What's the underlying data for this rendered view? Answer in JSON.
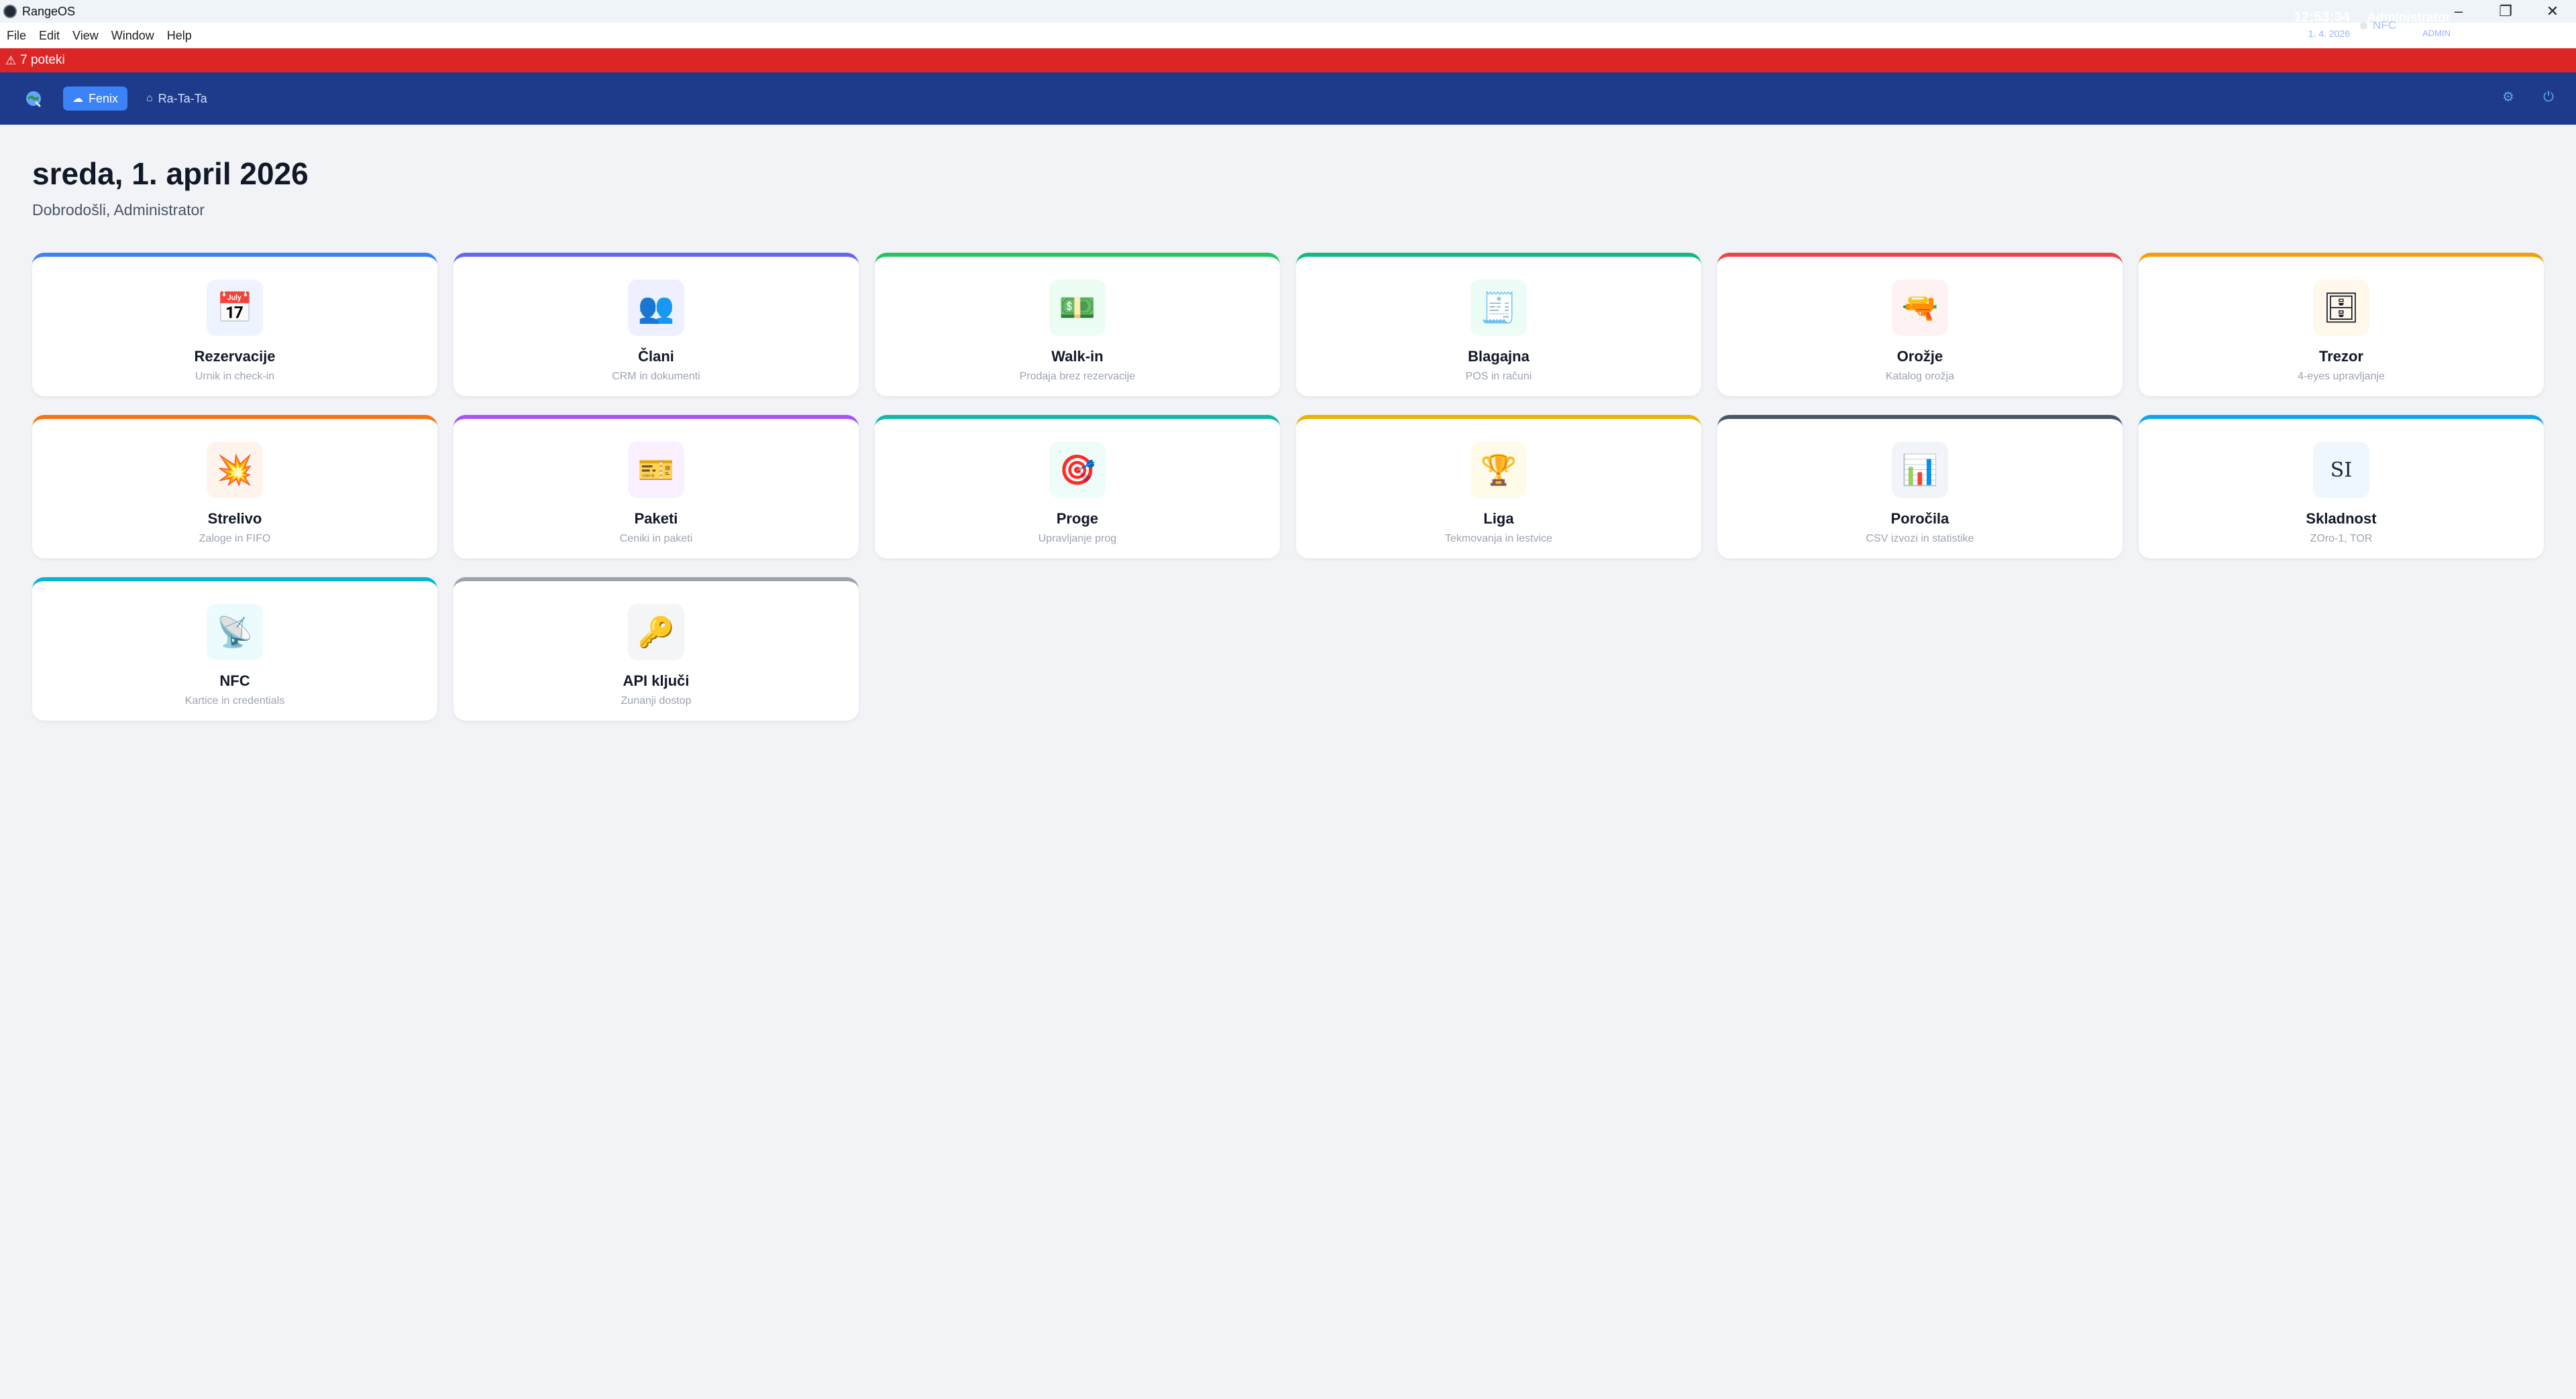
{
  "window": {
    "title": "RangeOS",
    "controls": {
      "minimize": "–",
      "restore": "❐",
      "close": "✕"
    }
  },
  "menu": [
    "File",
    "Edit",
    "View",
    "Window",
    "Help"
  ],
  "alert": {
    "icon": "warning-icon",
    "text": "7 poteki",
    "color": "#dc2626"
  },
  "header": {
    "bg": "#1e3a8a",
    "accent": "#3b82f6",
    "locations": [
      {
        "label": "Fenix",
        "icon": "cloud-icon",
        "active": true
      },
      {
        "label": "Ra-Ta-Ta",
        "icon": "building-icon",
        "active": false
      }
    ],
    "time": "12:53:34",
    "date": "1. 4. 2026",
    "nfc_label": "NFC",
    "user_name": "Administrator",
    "user_role": "ADMIN",
    "icons": [
      "settings-icon",
      "power-icon"
    ]
  },
  "main": {
    "title": "sreda, 1. april 2026",
    "subtitle": "Dobrodošli, Administrator"
  },
  "tiles": [
    {
      "title": "Rezervacije",
      "subtitle": "Urnik in check-in",
      "icon": "calendar-icon",
      "glyph": "📅",
      "accent": "#3b82f6",
      "bg": "#eef4ff"
    },
    {
      "title": "Člani",
      "subtitle": "CRM in dokumenti",
      "icon": "members-icon",
      "glyph": "👥",
      "accent": "#6366f1",
      "bg": "#eef0ff"
    },
    {
      "title": "Walk-in",
      "subtitle": "Prodaja brez rezervacije",
      "icon": "cash-icon",
      "glyph": "💵",
      "accent": "#22c55e",
      "bg": "#ecfdf3"
    },
    {
      "title": "Blagajna",
      "subtitle": "POS in računi",
      "icon": "receipt-icon",
      "glyph": "🧾",
      "accent": "#10b981",
      "bg": "#ecfdf5"
    },
    {
      "title": "Orožje",
      "subtitle": "Katalog orožja",
      "icon": "gun-icon",
      "glyph": "🔫",
      "accent": "#ef4444",
      "bg": "#fef2f2"
    },
    {
      "title": "Trezor",
      "subtitle": "4-eyes upravljanje",
      "icon": "safe-icon",
      "glyph": "🗄",
      "accent": "#f59e0b",
      "bg": "#fff8eb"
    },
    {
      "title": "Strelivo",
      "subtitle": "Zaloge in FIFO",
      "icon": "explosion-icon",
      "glyph": "💥",
      "accent": "#f97316",
      "bg": "#fff4ec"
    },
    {
      "title": "Paketi",
      "subtitle": "Ceniki in paketi",
      "icon": "ticket-icon",
      "glyph": "🎫",
      "accent": "#a855f7",
      "bg": "#faf0ff"
    },
    {
      "title": "Proge",
      "subtitle": "Upravljanje prog",
      "icon": "target-icon",
      "glyph": "🎯",
      "accent": "#14b8a6",
      "bg": "#eefcfa"
    },
    {
      "title": "Liga",
      "subtitle": "Tekmovanja in lestvice",
      "icon": "trophy-icon",
      "glyph": "🏆",
      "accent": "#eab308",
      "bg": "#fffbea"
    },
    {
      "title": "Poročila",
      "subtitle": "CSV izvozi in statistike",
      "icon": "chart-icon",
      "glyph": "📊",
      "accent": "#475569",
      "bg": "#f1f4f8"
    },
    {
      "title": "Skladnost",
      "subtitle": "ZOro-1, TOR",
      "icon": "compliance-icon",
      "glyph": "SI",
      "accent": "#0ea5e9",
      "bg": "#eef7fd"
    },
    {
      "title": "NFC",
      "subtitle": "Kartice in credentials",
      "icon": "antenna-icon",
      "glyph": "📡",
      "accent": "#06b6d4",
      "bg": "#ecfcfe"
    },
    {
      "title": "API ključi",
      "subtitle": "Zunanji dostop",
      "icon": "key-icon",
      "glyph": "🔑",
      "accent": "#9ca3af",
      "bg": "#f4f5f7"
    }
  ]
}
